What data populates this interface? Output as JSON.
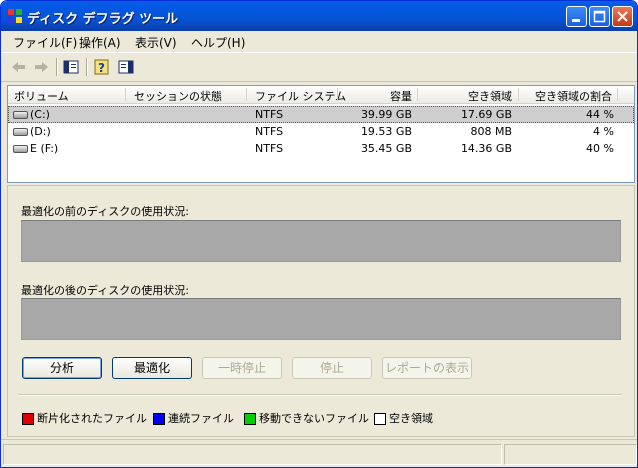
{
  "window": {
    "title": "ディスク デフラグ ツール"
  },
  "menu": {
    "file": "ファイル(F)",
    "action": "操作(A)",
    "view": "表示(V)",
    "help": "ヘルプ(H)"
  },
  "toolbar": {
    "icons": [
      "back-arrow-icon",
      "forward-arrow-icon",
      "show-hide-tree-icon",
      "help-icon",
      "properties-icon"
    ]
  },
  "volumes": {
    "headers": [
      "ボリューム",
      "セッションの状態",
      "ファイル システム",
      "容量",
      "空き領域",
      "空き領域の割合"
    ],
    "rows": [
      {
        "volume": "(C:)",
        "status": "",
        "fs": "NTFS",
        "capacity": "39.99 GB",
        "free": "17.69 GB",
        "percent": "44 %",
        "selected": true
      },
      {
        "volume": "(D:)",
        "status": "",
        "fs": "NTFS",
        "capacity": "19.53 GB",
        "free": "808 MB",
        "percent": "4 %",
        "selected": false
      },
      {
        "volume": "E (F:)",
        "status": "",
        "fs": "NTFS",
        "capacity": "35.45 GB",
        "free": "14.36 GB",
        "percent": "40 %",
        "selected": false
      }
    ]
  },
  "analysis": {
    "before_label": "最適化の前のディスクの使用状況:",
    "after_label": "最適化の後のディスクの使用状況:"
  },
  "buttons": {
    "analyze": "分析",
    "defragment": "最適化",
    "pause": "一時停止",
    "stop": "停止",
    "report": "レポートの表示"
  },
  "legend": [
    {
      "label": "断片化されたファイル",
      "color": "#e00000"
    },
    {
      "label": "連続ファイル",
      "color": "#0000f0"
    },
    {
      "label": "移動できないファイル",
      "color": "#00d000"
    },
    {
      "label": "空き領域",
      "color": "#ffffff"
    }
  ],
  "colors": {
    "title_bar": "#0458e3",
    "usage_bar": "#a8a8a8",
    "selection": "#cfcfcf"
  }
}
